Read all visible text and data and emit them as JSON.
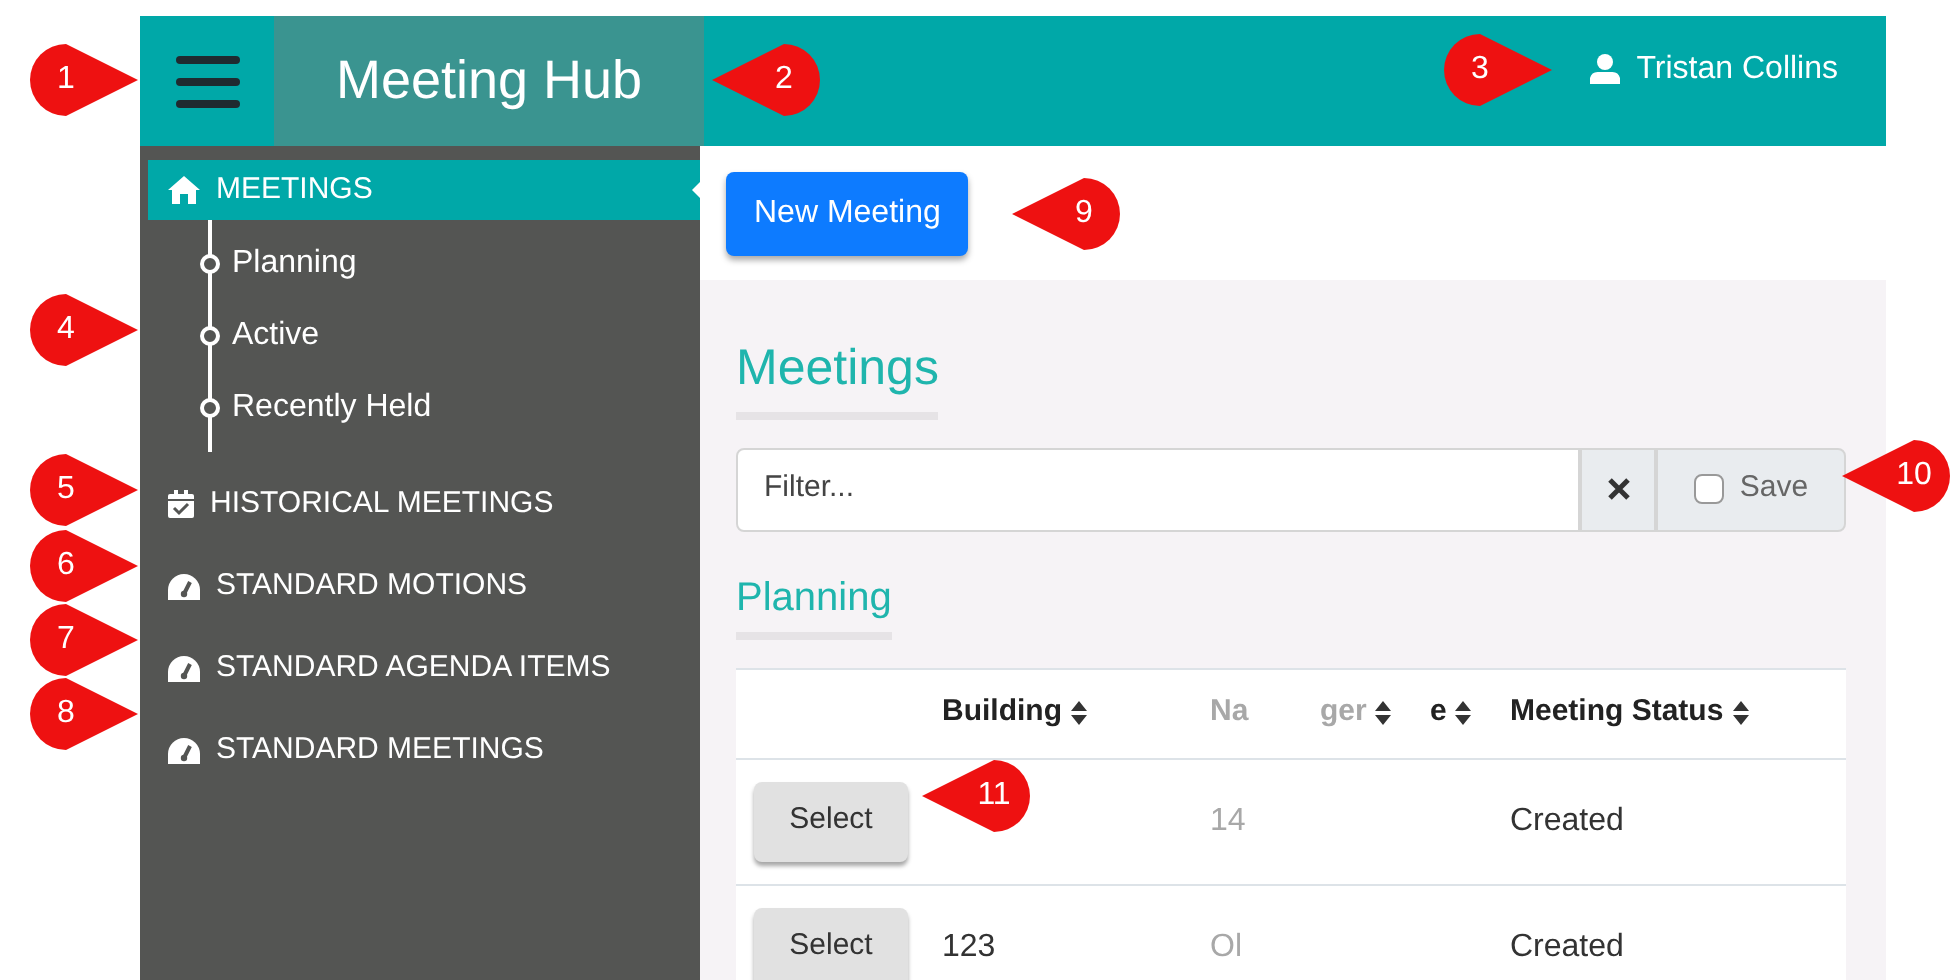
{
  "header": {
    "title": "Meeting Hub",
    "user": "Tristan Collins"
  },
  "sidebar": {
    "items": [
      {
        "label": "MEETINGS",
        "kind": "home",
        "selected": true,
        "children": [
          {
            "label": "Planning"
          },
          {
            "label": "Active"
          },
          {
            "label": "Recently Held"
          }
        ]
      },
      {
        "label": "HISTORICAL MEETINGS",
        "kind": "calendar",
        "selected": false
      },
      {
        "label": "STANDARD MOTIONS",
        "kind": "gauge",
        "selected": false
      },
      {
        "label": "STANDARD AGENDA ITEMS",
        "kind": "gauge",
        "selected": false
      },
      {
        "label": "STANDARD MEETINGS",
        "kind": "gauge",
        "selected": false
      }
    ]
  },
  "new_meeting_button": "New Meeting",
  "page_title": "Meetings",
  "filter": {
    "placeholder": "Filter...",
    "save_label": "Save",
    "save_checked": false
  },
  "section_title": "Planning",
  "table": {
    "columns": [
      {
        "label": "Building",
        "faded": false,
        "sortable": true
      },
      {
        "label": "Na",
        "faded": true,
        "sortable": false
      },
      {
        "label": "ger",
        "faded": true,
        "sortable": true
      },
      {
        "label": "e",
        "faded": false,
        "sortable": true
      },
      {
        "label": "Meeting Status",
        "faded": false,
        "sortable": true
      }
    ],
    "rows": [
      {
        "action": "Select",
        "cells": [
          "",
          "14",
          "",
          "",
          "Created"
        ]
      },
      {
        "action": "Select",
        "cells": [
          "123",
          "Ol",
          "",
          "",
          "Created"
        ]
      }
    ]
  },
  "callouts": [
    "1",
    "2",
    "3",
    "4",
    "5",
    "6",
    "7",
    "8",
    "9",
    "10",
    "11"
  ]
}
